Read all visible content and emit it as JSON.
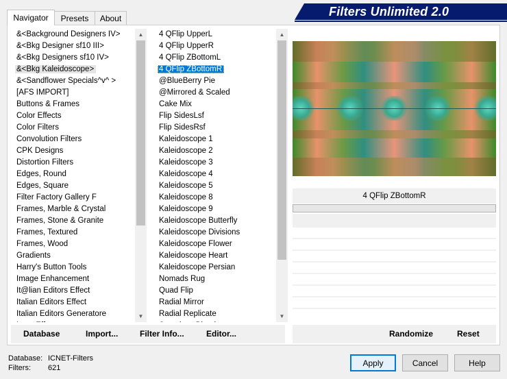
{
  "tabs": [
    {
      "label": "Navigator",
      "active": true
    },
    {
      "label": "Presets",
      "active": false
    },
    {
      "label": "About",
      "active": false
    }
  ],
  "title": "Filters Unlimited 2.0",
  "categories": {
    "items": [
      "&<Background Designers IV>",
      "&<Bkg Designer sf10 III>",
      "&<Bkg Designers sf10 IV>",
      "&<Bkg Kaleidoscope>",
      "&<Sandflower Specials^v^ >",
      "[AFS IMPORT]",
      "Buttons & Frames",
      "Color Effects",
      "Color Filters",
      "Convolution Filters",
      "CPK Designs",
      "Distortion Filters",
      "Edges, Round",
      "Edges, Square",
      "Filter Factory Gallery F",
      "Frames, Marble & Crystal",
      "Frames, Stone & Granite",
      "Frames, Textured",
      "Frames, Wood",
      "Gradients",
      "Harry's Button Tools",
      "Image Enhancement",
      "It@lian Editors Effect",
      "Italian Editors Effect",
      "Italian Editors Generatore",
      "Lens Effects"
    ],
    "highlighted": "&<Bkg Kaleidoscope>"
  },
  "filters": {
    "items": [
      "4 QFlip UpperL",
      "4 QFlip UpperR",
      "4 QFlip ZBottomL",
      "4 QFlip ZBottomR",
      "@BlueBerry Pie",
      "@Mirrored & Scaled",
      "Cake Mix",
      "Flip SidesLsf",
      "Flip SidesRsf",
      "Kaleidoscope 1",
      "Kaleidoscope 2",
      "Kaleidoscope 3",
      "Kaleidoscope 4",
      "Kaleidoscope 5",
      "Kaleidoscope 8",
      "Kaleidoscope 9",
      "Kaleidoscope Butterfly",
      "Kaleidoscope Divisions",
      "Kaleidoscope Flower",
      "Kaleidoscope Heart",
      "Kaleidoscope Persian",
      "Nomads Rug",
      "Quad Flip",
      "Radial Mirror",
      "Radial Replicate",
      "Seamless Blend"
    ],
    "selected": "4 QFlip ZBottomR"
  },
  "preview": {
    "filter_name": "4 QFlip ZBottomR"
  },
  "toolbar": {
    "database": "Database",
    "import": "Import...",
    "filter_info": "Filter Info...",
    "editor": "Editor...",
    "randomize": "Randomize",
    "reset": "Reset"
  },
  "status": {
    "database_label": "Database:",
    "database_value": "ICNET-Filters",
    "filters_label": "Filters:",
    "filters_value": "621"
  },
  "buttons": {
    "apply": "Apply",
    "cancel": "Cancel",
    "help": "Help"
  },
  "colors": {
    "accent": "#0078d7",
    "logo_bg": "#061a6e"
  }
}
